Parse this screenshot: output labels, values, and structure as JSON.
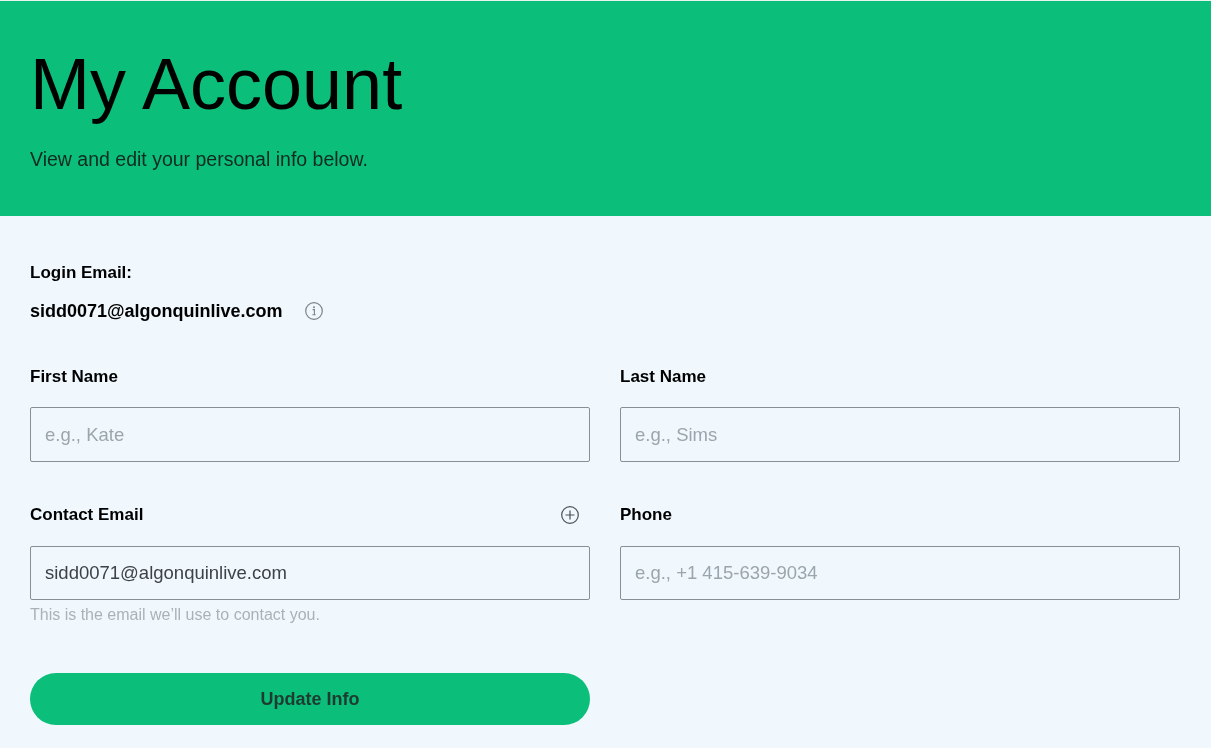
{
  "header": {
    "title": "My Account",
    "subtitle": "View and edit your personal info below."
  },
  "login_email": {
    "label": "Login Email:",
    "value": "sidd0071@algonquinlive.com"
  },
  "fields": [
    {
      "kind": "text",
      "label": "First Name",
      "placeholder": "e.g., Kate"
    },
    {
      "kind": "text",
      "label": "Last Name",
      "placeholder": "e.g., Sims"
    },
    {
      "kind": "email",
      "label": "Contact Email",
      "value": "sidd0071@algonquinlive.com",
      "hint": "This is the email we’ll use to contact you."
    },
    {
      "kind": "text",
      "label": "Phone",
      "placeholder": "e.g., +1 415-639-9034"
    }
  ],
  "submit_button": {
    "label": "Update Info"
  }
}
